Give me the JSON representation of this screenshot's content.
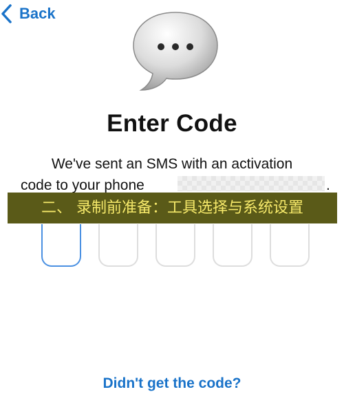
{
  "nav": {
    "back_label": "Back",
    "back_icon": "chevron-left-icon"
  },
  "header": {
    "icon": "message-bubble-icon",
    "title": "Enter Code"
  },
  "message": {
    "line1": "We've sent an SMS with an activation",
    "line2": "code to your phone",
    "line_end": "."
  },
  "overlay_banner": {
    "text": "二、 录制前准备：工具选择与系统设置"
  },
  "code_input": {
    "boxes": [
      "",
      "",
      "",
      "",
      ""
    ],
    "active_index": 0
  },
  "resend": {
    "label": "Didn't get the code?"
  },
  "colors": {
    "accent": "#1a73c9",
    "active_border": "#4a90e2",
    "inactive_border": "#dddddd",
    "banner_bg": "#5a5a18",
    "banner_text": "#f6e96a"
  }
}
